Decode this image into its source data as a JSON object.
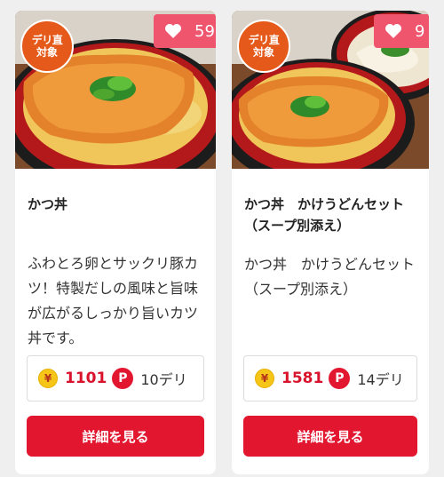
{
  "colors": {
    "accent": "#e3162f",
    "likes_badge": "#f0556e",
    "delivery_badge": "#e55a1a",
    "price_text": "#d8132b",
    "coin": "#f5c518"
  },
  "cards": [
    {
      "badge_line1": "デリ直",
      "badge_line2": "対象",
      "heart_icon": "heart-icon",
      "likes": "59",
      "title": "かつ丼",
      "description": "ふわとろ卵とサックリ豚カツ！特製だしの風味と旨味が広がるしっかり旨いカツ丼です。",
      "yen_symbol": "¥",
      "price": "1101",
      "point_symbol": "P",
      "points": "10デリ",
      "button_label": "詳細を見る"
    },
    {
      "badge_line1": "デリ直",
      "badge_line2": "対象",
      "heart_icon": "heart-icon",
      "likes": "9",
      "title": "かつ丼　かけうどんセット（スープ別添え）",
      "description": "かつ丼　かけうどんセット（スープ別添え）",
      "yen_symbol": "¥",
      "price": "1581",
      "point_symbol": "P",
      "points": "14デリ",
      "button_label": "詳細を見る"
    }
  ]
}
